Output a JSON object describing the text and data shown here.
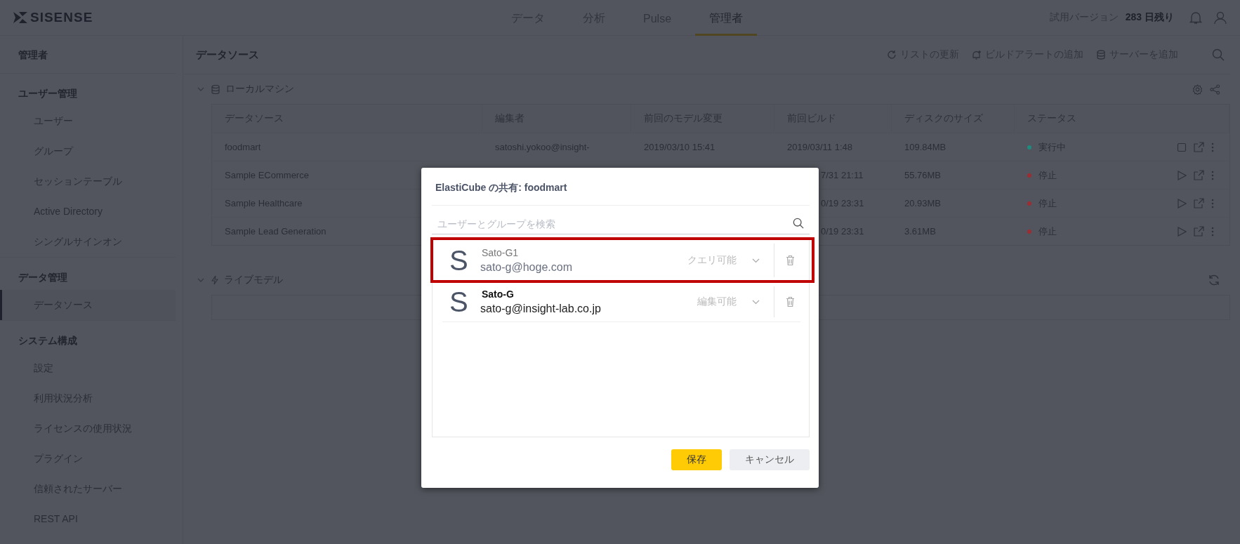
{
  "topbar": {
    "logo": "SISENSE",
    "nav": [
      {
        "label": "データ",
        "selected": false
      },
      {
        "label": "分析",
        "selected": false
      },
      {
        "label": "Pulse",
        "selected": false
      },
      {
        "label": "管理者",
        "selected": true
      }
    ],
    "trial_label": "試用バージョン",
    "trial_days": "283 日残り"
  },
  "sidebar": {
    "title": "管理者",
    "sections": [
      {
        "heading": "ユーザー管理",
        "items": [
          {
            "label": "ユーザー",
            "selected": false
          },
          {
            "label": "グループ",
            "selected": false
          },
          {
            "label": "セッションテーブル",
            "selected": false
          },
          {
            "label": "Active Directory",
            "selected": false
          },
          {
            "label": "シングルサインオン",
            "selected": false
          }
        ]
      },
      {
        "heading": "データ管理",
        "items": [
          {
            "label": "データソース",
            "selected": true
          }
        ]
      },
      {
        "heading": "システム構成",
        "items": [
          {
            "label": "設定",
            "selected": false
          },
          {
            "label": "利用状況分析",
            "selected": false
          },
          {
            "label": "ライセンスの使用状況",
            "selected": false
          },
          {
            "label": "プラグイン",
            "selected": false
          },
          {
            "label": "信頼されたサーバー",
            "selected": false
          },
          {
            "label": "REST API",
            "selected": false
          }
        ]
      }
    ]
  },
  "page_header": {
    "title": "データソース",
    "actions": [
      {
        "kind": "refresh",
        "label": "リストの更新"
      },
      {
        "kind": "alert",
        "label": "ビルドアラートの追加"
      },
      {
        "kind": "server",
        "label": "サーバーを追加"
      }
    ]
  },
  "local_section": {
    "title": "ローカルマシン",
    "expanded": true,
    "table": {
      "columns": [
        "データソース",
        "編集者",
        "前回のモデル変更",
        "前回ビルド",
        "ディスクのサイズ",
        "ステータス"
      ],
      "rows": [
        {
          "name": "foodmart",
          "editor": "satoshi.yokoo@insight-",
          "model_change": "2019/03/10 15:41",
          "build": "2019/03/11 1:48",
          "size": "109.84MB",
          "status": "実行中",
          "running": true,
          "color": "#1f8a80"
        },
        {
          "name": "Sample ECommerce",
          "build": "7/31 21:11",
          "size": "55.76MB",
          "status": "停止",
          "running": false,
          "color": "#9b2d33"
        },
        {
          "name": "Sample Healthcare",
          "build": "0/19 23:31",
          "size": "20.93MB",
          "status": "停止",
          "running": false,
          "color": "#9b2d33"
        },
        {
          "name": "Sample Lead Generation",
          "build": "0/19 23:31",
          "size": "3.61MB",
          "status": "停止",
          "running": false,
          "color": "#9b2d33"
        }
      ]
    }
  },
  "live_section": {
    "title": "ライブモデル",
    "expanded": true
  },
  "dialog": {
    "title": "ElastiCube の共有: foodmart",
    "search": {
      "placeholder": "ユーザーとグループを検索"
    },
    "entries": [
      {
        "avatar": "S",
        "name": "Sato-G1",
        "email": "sato-g@hoge.com",
        "permission": "クエリ可能",
        "highlighted": true
      },
      {
        "avatar": "S",
        "name": "Sato-G",
        "email": "sato-g@insight-lab.co.jp",
        "permission": "編集可能",
        "highlighted": false
      }
    ],
    "buttons": [
      {
        "kind": "primary",
        "label": "保存"
      },
      {
        "kind": "secondary",
        "label": "キャンセル"
      }
    ]
  }
}
